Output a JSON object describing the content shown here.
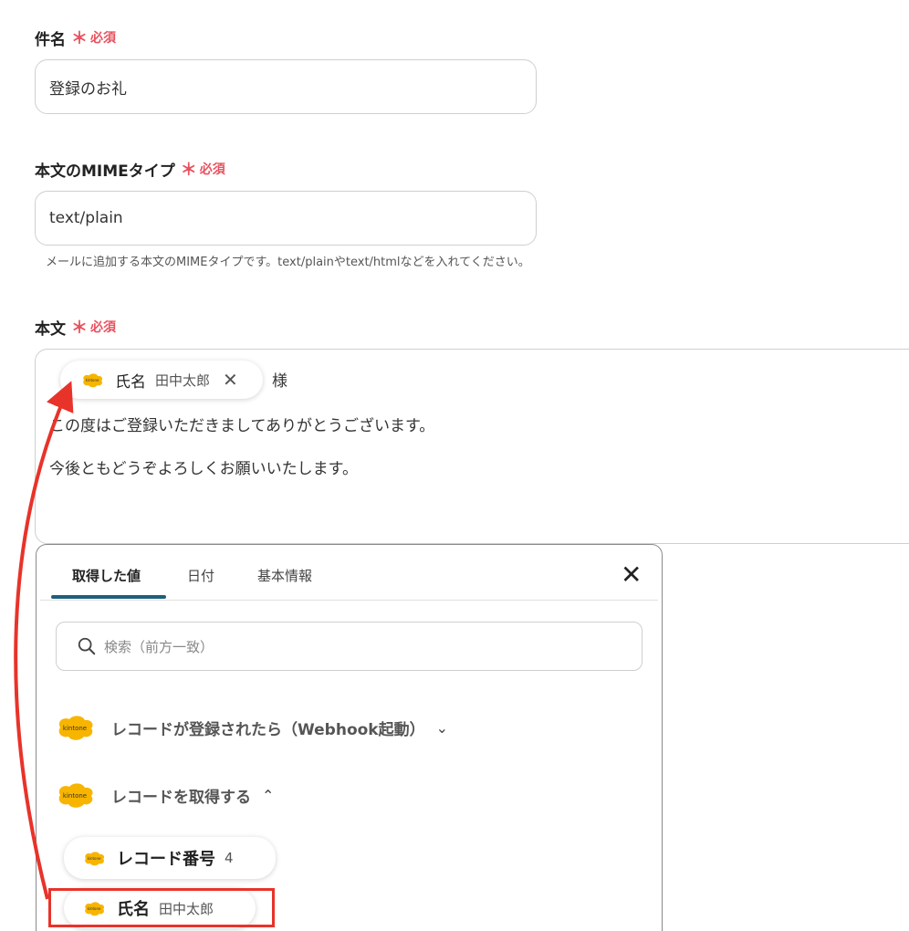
{
  "subject": {
    "label": "件名",
    "required_star": "＊",
    "required_text": "必須",
    "value": "登録のお礼"
  },
  "mime": {
    "label": "本文のMIMEタイプ",
    "required_star": "＊",
    "required_text": "必須",
    "value": "text/plain",
    "hint": "メールに追加する本文のMIMEタイプです。text/plainやtext/htmlなどを入れてください。"
  },
  "body": {
    "label": "本文",
    "required_star": "＊",
    "required_text": "必須",
    "chip": {
      "label": "氏名",
      "value": "田中太郎",
      "close": "✕"
    },
    "suffix": "様",
    "line1": "この度はご登録いただきましてありがとうございます。",
    "line2": "今後ともどうぞよろしくお願いいたします。"
  },
  "panel": {
    "tabs": [
      {
        "label": "取得した値"
      },
      {
        "label": "日付"
      },
      {
        "label": "基本情報"
      }
    ],
    "close": "✕",
    "search_placeholder": "検索（前方一致）",
    "groups": [
      {
        "label": "レコードが登録されたら（Webhook起動）",
        "chevron": "⌄"
      },
      {
        "label": "レコードを取得する",
        "chevron": "⌃"
      }
    ],
    "items": [
      {
        "label": "レコード番号",
        "value": "4"
      },
      {
        "label": "氏名",
        "value": "田中太郎"
      }
    ]
  },
  "logo_text": "kintone",
  "colors": {
    "required": "#e8515e",
    "tab_active": "#1d5f7a",
    "logo": "#f7b500",
    "highlight": "#e8332a"
  }
}
